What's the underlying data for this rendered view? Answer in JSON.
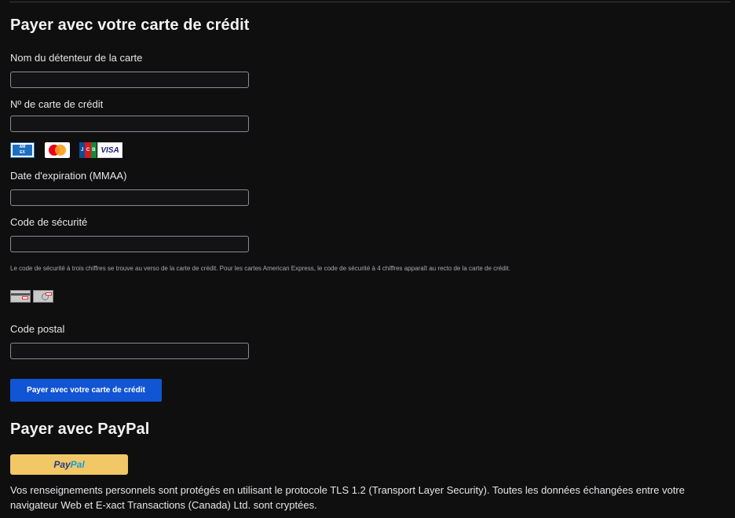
{
  "credit_card": {
    "title": "Payer avec votre carte de crédit",
    "cardholder_label": "Nom du détenteur de la carte",
    "cardholder_value": "",
    "card_number_label": "Nº de carte de crédit",
    "card_number_value": "",
    "accepted_cards": [
      "amex-icon",
      "mastercard-icon",
      "jcb-icon",
      "visa-icon"
    ],
    "visa_text": "VISA",
    "expiry_label": "Date d'expiration (MMAA)",
    "expiry_value": "",
    "security_label": "Code de sécurité",
    "security_value": "",
    "security_hint": "Le code de sécurité à trois chiffres se trouve au verso de la carte de crédit. Pour les cartes American Express, le code de sécurité à 4 chiffres apparaît au recto de la carte de crédit.",
    "postal_label": "Code postal",
    "postal_value": "",
    "submit_label": "Payer avec votre carte de crédit"
  },
  "paypal": {
    "title": "Payer avec PayPal",
    "button_pay": "Pay",
    "button_pal": "Pal"
  },
  "security_notice": "Vos renseignements personnels sont protégés en utilisant le protocole TLS 1.2 (Transport Layer Security). Toutes les données échangées entre votre navigateur Web et E-xact Transactions (Canada) Ltd. sont cryptées.",
  "colors": {
    "background": "#0f0f10",
    "primary_button": "#1155d4",
    "paypal_button": "#f2c867"
  }
}
